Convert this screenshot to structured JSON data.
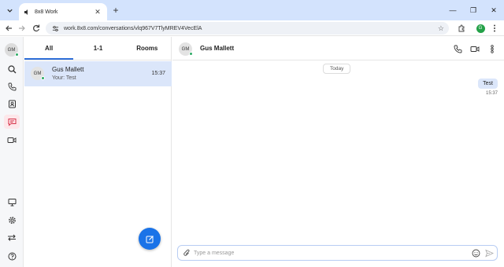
{
  "browser": {
    "tab_title": "8x8 Work",
    "new_tab_icon": "plus-icon",
    "url": "work.8x8.com/conversations/vlq967V7TlyMREV4VecElA",
    "profile_initial": "G"
  },
  "rail": {
    "avatar_initials": "GM",
    "items": [
      {
        "icon": "search-icon"
      },
      {
        "icon": "phone-icon"
      },
      {
        "icon": "contacts-icon"
      },
      {
        "icon": "chat-icon",
        "active": true
      },
      {
        "icon": "video-icon"
      },
      {
        "icon": "desktop-icon"
      },
      {
        "icon": "gear-icon"
      },
      {
        "icon": "switch-icon"
      },
      {
        "icon": "help-icon"
      }
    ]
  },
  "conversations": {
    "tabs": [
      "All",
      "1-1",
      "Rooms"
    ],
    "active_tab": "All",
    "items": [
      {
        "initials": "GM",
        "name": "Gus Mallett",
        "preview": "Your: Test",
        "time": "15:37"
      }
    ]
  },
  "chat": {
    "avatar_initials": "GM",
    "contact_name": "Gus Mallett",
    "date_divider": "Today",
    "messages": [
      {
        "text": "Test",
        "time": "15:37",
        "outgoing": true
      }
    ],
    "composer_placeholder": "Type a message"
  },
  "colors": {
    "accent": "#1a73e8",
    "selected_row": "#dbe6fa",
    "presence": "#2dab66",
    "chat_active": "#d6334a"
  }
}
